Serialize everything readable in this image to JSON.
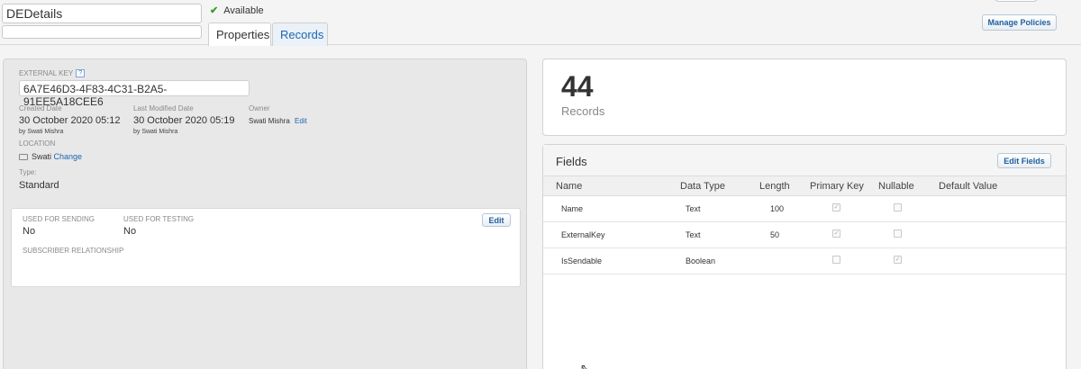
{
  "header": {
    "name_value": "DEDetails",
    "description_value": "",
    "status_text": "Available",
    "status_icon": "checkmark-icon",
    "manage_policies_label": "Manage Policies"
  },
  "tabs": [
    {
      "label": "Properties",
      "active": true
    },
    {
      "label": "Records",
      "active": false
    }
  ],
  "properties": {
    "external_key_label": "EXTERNAL KEY",
    "help_glyph": "?",
    "external_key_value": "6A7E46D3-4F83-4C31-B2A5-91EE5A18CEE6",
    "created_date_label": "Created Date",
    "created_date_value": "30 October 2020 05:12",
    "created_by": "by Swati Mishra",
    "modified_date_label": "Last Modified Date",
    "modified_date_value": "30 October 2020 05:19",
    "modified_by": "by Swati Mishra",
    "owner_label": "Owner",
    "owner_value": "Swati Mishra",
    "owner_edit_label": "Edit",
    "location_label": "LOCATION",
    "location_value": "Swati",
    "location_change_label": "Change",
    "type_label": "Type:",
    "type_value": "Standard"
  },
  "sending": {
    "used_for_sending_label": "USED FOR SENDING",
    "used_for_sending_value": "No",
    "used_for_testing_label": "USED FOR TESTING",
    "used_for_testing_value": "No",
    "subscriber_relationship_label": "SUBSCRIBER RELATIONSHIP",
    "edit_label": "Edit"
  },
  "records": {
    "count": "44",
    "label": "Records"
  },
  "fields": {
    "title": "Fields",
    "edit_fields_label": "Edit Fields",
    "columns": [
      "Name",
      "Data Type",
      "Length",
      "Primary Key",
      "Nullable",
      "Default Value"
    ],
    "rows": [
      {
        "name": "Name",
        "data_type": "Text",
        "length": "100",
        "primary_key": true,
        "nullable": false,
        "default_value": ""
      },
      {
        "name": "ExternalKey",
        "data_type": "Text",
        "length": "50",
        "primary_key": true,
        "nullable": false,
        "default_value": ""
      },
      {
        "name": "IsSendable",
        "data_type": "Boolean",
        "length": "",
        "primary_key": false,
        "nullable": true,
        "default_value": ""
      }
    ]
  },
  "colors": {
    "link": "#1d66b0",
    "status_check": "#3c9a2d",
    "panel_bg": "#e8e8e8"
  }
}
